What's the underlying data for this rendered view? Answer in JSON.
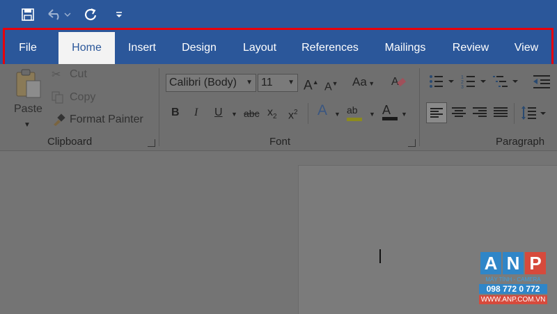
{
  "quick_access": {
    "save_icon": "save-icon",
    "undo_icon": "undo-icon",
    "redo_icon": "redo-icon",
    "customize_icon": "customize-qat-icon"
  },
  "tabs": {
    "file": "File",
    "home": "Home",
    "insert": "Insert",
    "design": "Design",
    "layout": "Layout",
    "references": "References",
    "mailings": "Mailings",
    "review": "Review",
    "view": "View"
  },
  "active_tab": "Home",
  "clipboard": {
    "paste": "Paste",
    "cut": "Cut",
    "copy": "Copy",
    "format_painter": "Format Painter",
    "group_label": "Clipboard"
  },
  "font": {
    "font_name": "Calibri (Body)",
    "font_size": "11",
    "grow_label": "A",
    "shrink_label": "A",
    "change_case": "Aa",
    "bold": "B",
    "italic": "I",
    "underline": "U",
    "strikethrough": "abc",
    "subscript": "x",
    "subscript_mark": "2",
    "superscript": "x",
    "superscript_mark": "2",
    "text_effects": "A",
    "highlight": "ab",
    "font_color": "A",
    "group_label": "Font"
  },
  "paragraph": {
    "group_label": "Paragraph"
  },
  "watermark": {
    "letters": [
      "A",
      "N",
      "P"
    ],
    "subtitle": "MÁY TÍNH - CAMERA",
    "phone": "098 772 0 772",
    "website": "WWW.ANP.COM.VN"
  },
  "colors": {
    "title_bar": "#2b579a",
    "active_tab_bg": "#f3f3f3",
    "highlight_border": "#e8000b",
    "wm_a": "#2f86c8",
    "wm_n": "#2f86c8",
    "wm_p": "#d64a3c"
  }
}
